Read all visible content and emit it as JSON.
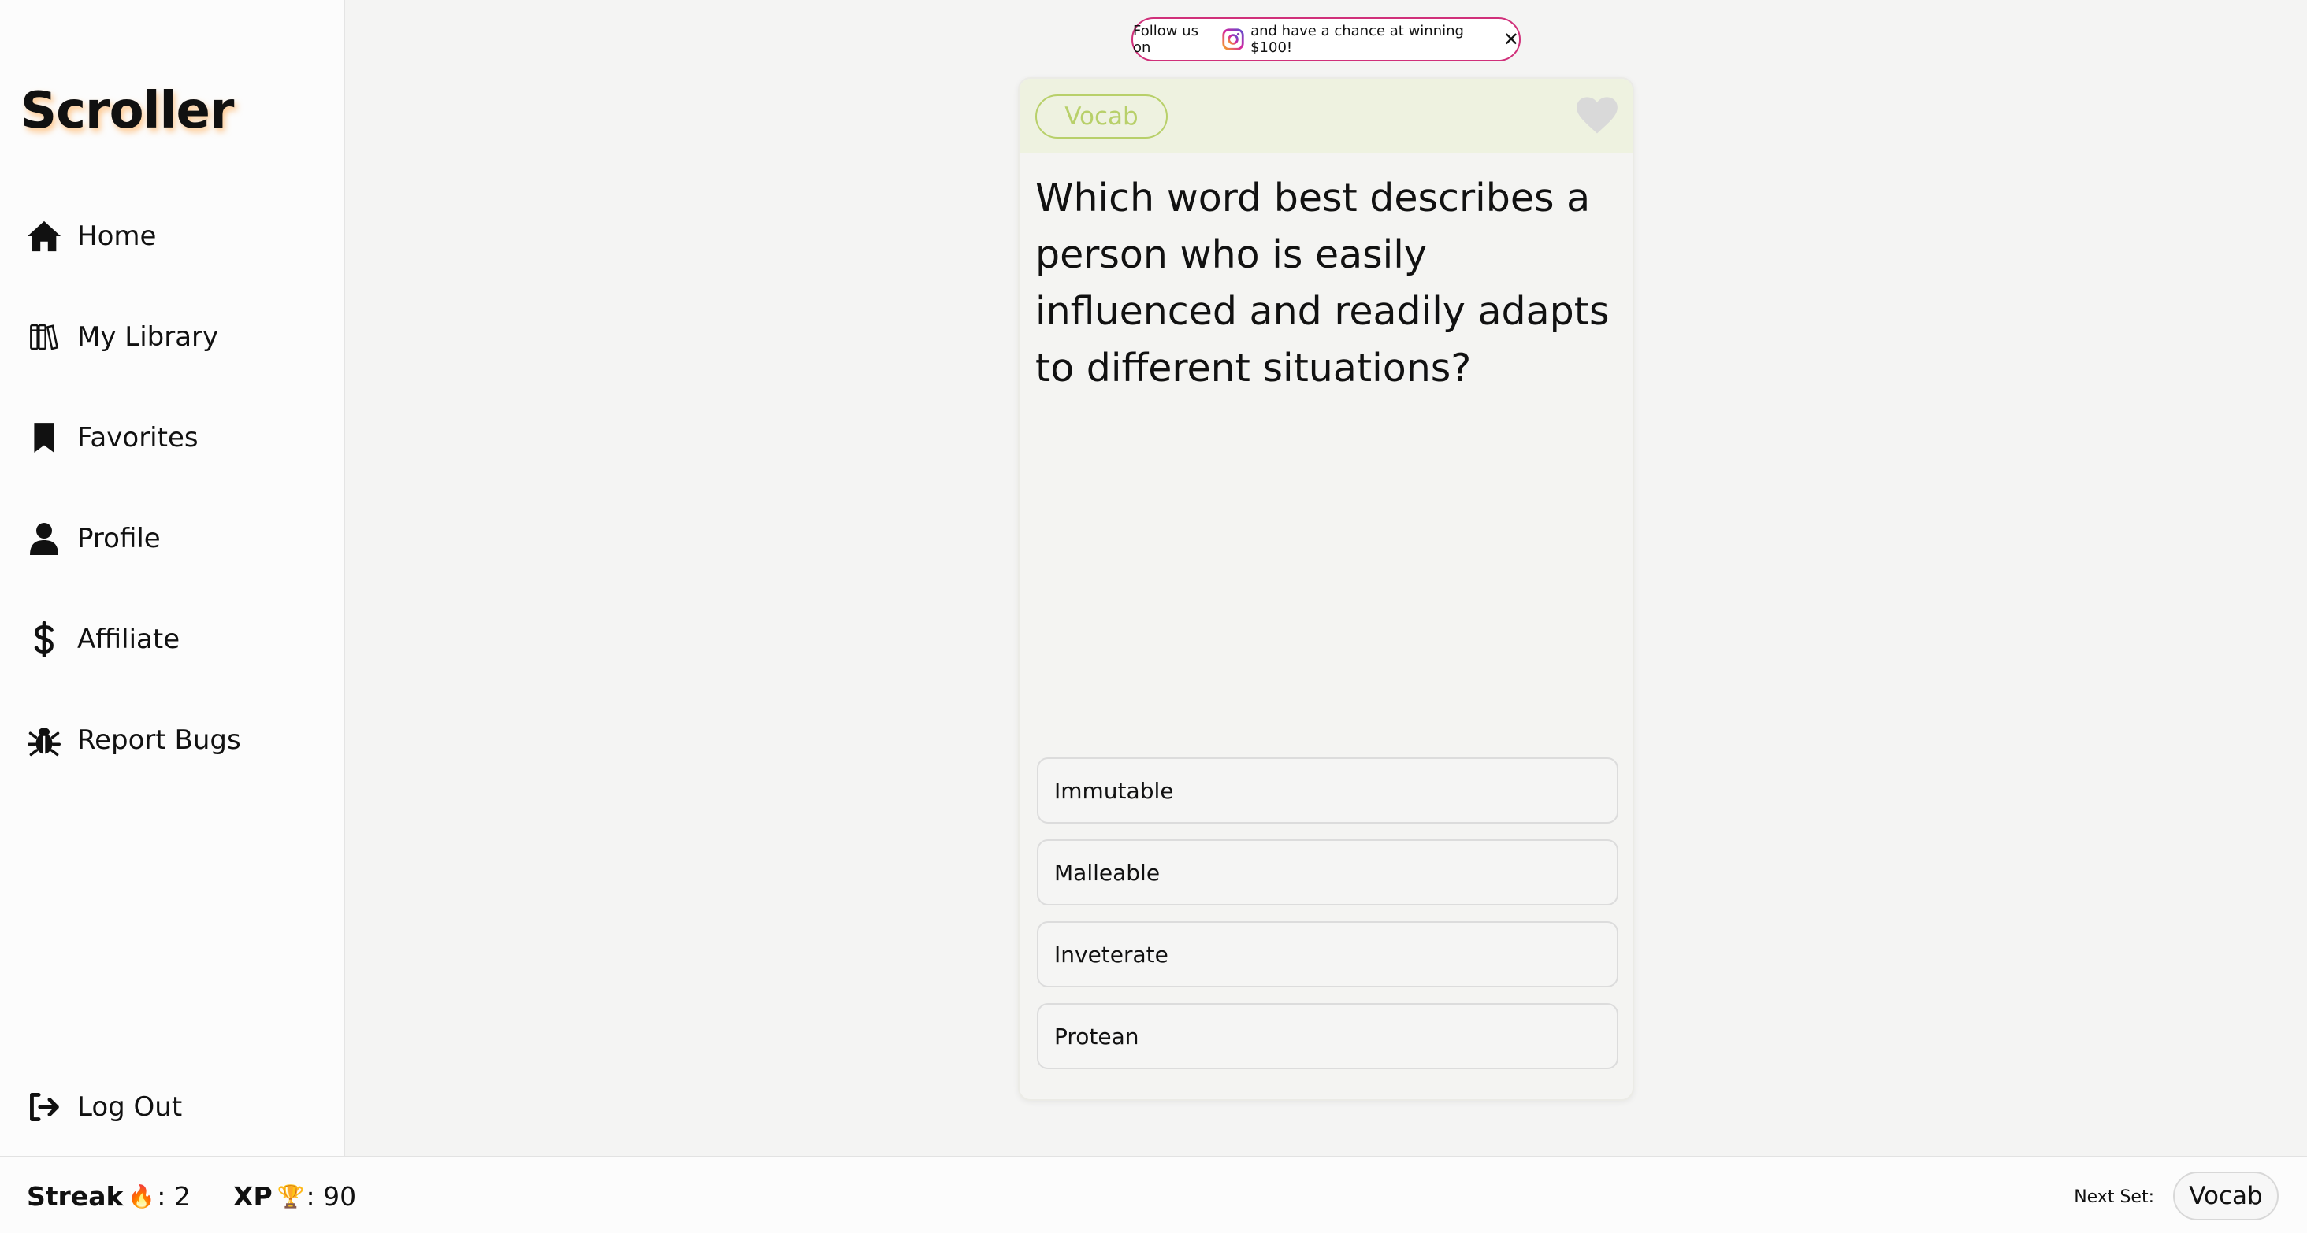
{
  "app": {
    "logo": "Scroller"
  },
  "sidebar": {
    "items": [
      {
        "label": "Home",
        "icon": "home-icon"
      },
      {
        "label": "My Library",
        "icon": "library-icon"
      },
      {
        "label": "Favorites",
        "icon": "bookmark-icon"
      },
      {
        "label": "Profile",
        "icon": "user-icon"
      },
      {
        "label": "Affiliate",
        "icon": "dollar-icon"
      },
      {
        "label": "Report Bugs",
        "icon": "bug-icon"
      }
    ],
    "logout": {
      "label": "Log Out",
      "icon": "logout-icon"
    }
  },
  "banner": {
    "text_before": "Follow us on",
    "icon": "instagram-icon",
    "text_after": "and have a chance at winning $100!",
    "close": "✕"
  },
  "card": {
    "tag": "Vocab",
    "question": "Which word best describes a person who is easily influenced and readily adapts to different situations?",
    "options": [
      "Immutable",
      "Malleable",
      "Inveterate",
      "Protean"
    ],
    "colors": {
      "tag": "#b8d06a",
      "header_bg": "#eef2e0"
    }
  },
  "footer": {
    "streak_label": "Streak",
    "streak_emoji": "🔥",
    "streak_value": ": 2",
    "xp_label": "XP",
    "xp_emoji": "🏆",
    "xp_value": ": 90",
    "next_set_label": "Next Set:",
    "next_set_value": "Vocab"
  }
}
